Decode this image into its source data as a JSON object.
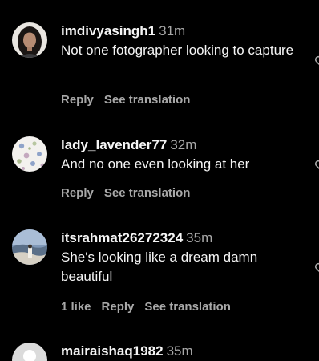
{
  "comments": [
    {
      "username": "imdivyasingh1",
      "time": "31m",
      "text": "Not one fotographer looking to capture",
      "likes": "",
      "reply_label": "Reply",
      "translate_label": "See translation",
      "avatar_icon": "woman-portrait-avatar",
      "like_icon": "heart-outline-icon"
    },
    {
      "username": "lady_lavender77",
      "time": "32m",
      "text": "And no one even looking at her",
      "likes": "",
      "reply_label": "Reply",
      "translate_label": "See translation",
      "avatar_icon": "floral-pattern-avatar",
      "like_icon": "heart-outline-icon"
    },
    {
      "username": "itsrahmat26272324",
      "time": "35m",
      "text": "She's looking like a dream damn beautiful",
      "likes": "1 like",
      "reply_label": "Reply",
      "translate_label": "See translation",
      "avatar_icon": "landscape-photo-avatar",
      "like_icon": "heart-outline-icon"
    },
    {
      "username": "mairaishaq1982",
      "time": "35m",
      "avatar_icon": "default-user-avatar"
    }
  ],
  "colors": {
    "background": "#000000",
    "primary_text": "#f5f5f5",
    "secondary_text": "#a8a8a8"
  }
}
